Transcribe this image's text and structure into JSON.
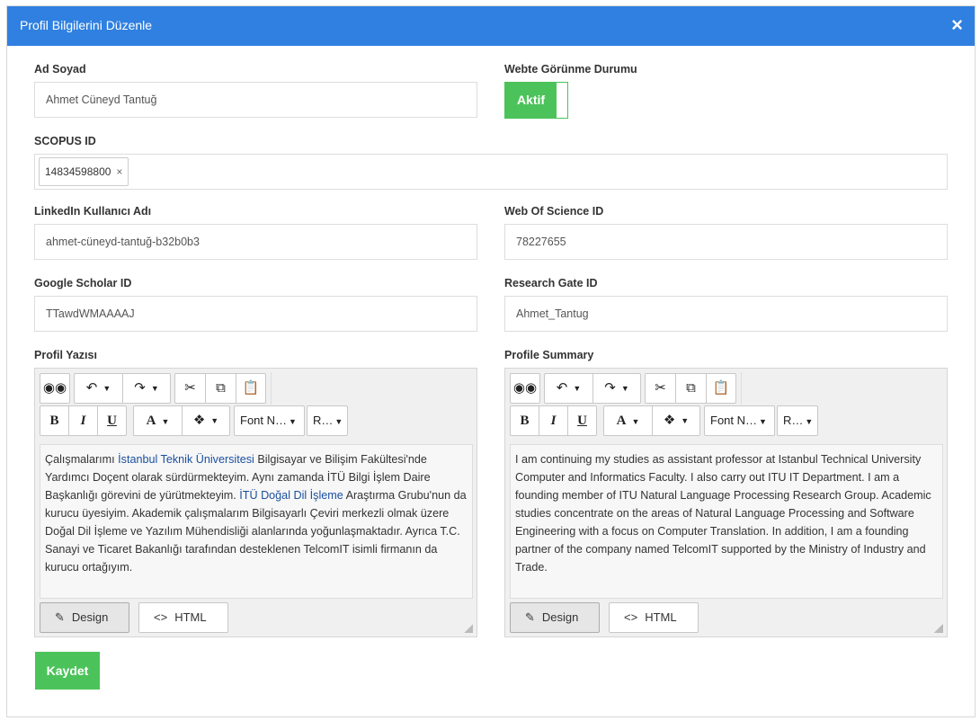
{
  "modal": {
    "title": "Profil Bilgilerini Düzenle",
    "close_icon": "×"
  },
  "fields": {
    "name": {
      "label": "Ad Soyad",
      "value": "Ahmet Cüneyd Tantuğ"
    },
    "visibility": {
      "label": "Webte Görünme Durumu",
      "state": "Aktif"
    },
    "scopus": {
      "label": "SCOPUS ID",
      "tags": [
        "14834598800"
      ],
      "remove_icon": "×"
    },
    "linkedin": {
      "label": "LinkedIn Kullanıcı Adı",
      "value": "ahmet-cüneyd-tantuğ-b32b0b3"
    },
    "wos": {
      "label": "Web Of Science ID",
      "value": "78227655"
    },
    "scholar": {
      "label": "Google Scholar ID",
      "value": "TTawdWMAAAAJ"
    },
    "researchgate": {
      "label": "Research Gate ID",
      "value": "Ahmet_Tantug"
    }
  },
  "toolbar": {
    "font_name": "Font N…",
    "font_size": "R…",
    "bold": "B",
    "italic": "I",
    "underline": "U",
    "font_color": "A",
    "design": "Design",
    "html": "HTML"
  },
  "editors": {
    "tr": {
      "label": "Profil Yazısı",
      "parts": [
        "Çalışmalarımı ",
        "İstanbul Teknik Üniversitesi",
        " Bilgisayar ve Bilişim Fakültesi'nde Yardımcı Doçent olarak sürdürmekteyim. Aynı zamanda İTÜ Bilgi İşlem Daire Başkanlığı görevini de yürütmekteyim. ",
        "İTÜ Doğal Dil İşleme",
        " Araştırma Grubu'nun da kurucu üyesiyim. Akademik çalışmalarım Bilgisayarlı Çeviri merkezli olmak üzere Doğal Dil İşleme ve Yazılım Mühendisliği alanlarında yoğunlaşmaktadır. Ayrıca T.C. Sanayi ve Ticaret Bakanlığı tarafından desteklenen TelcomIT isimli firmanın da kurucu ortağıyım."
      ]
    },
    "en": {
      "label": "Profile Summary",
      "text": "I am continuing my studies as assistant professor at Istanbul Technical University Computer and Informatics Faculty. I also carry out ITU IT Department. I am a founding member of ITU Natural Language Processing Research Group. Academic studies concentrate on the areas of Natural Language Processing and Software Engineering with a focus on Computer Translation. In addition, I am a founding partner of the company named TelcomIT supported by the Ministry of Industry and Trade."
    }
  },
  "save_label": "Kaydet",
  "colors": {
    "header": "#2f80e0",
    "success": "#4cc35a",
    "link": "#1a4f9e"
  }
}
